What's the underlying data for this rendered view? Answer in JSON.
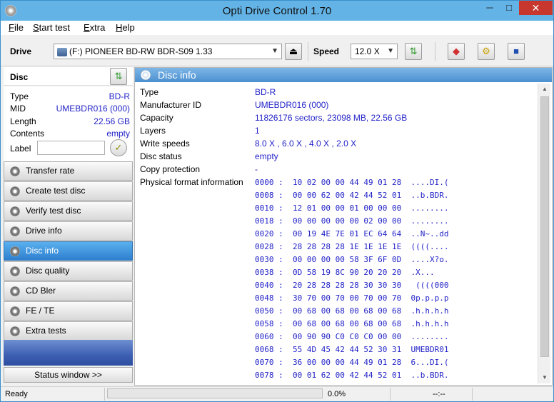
{
  "window": {
    "title": "Opti Drive Control 1.70",
    "min": "─",
    "max": "□",
    "close": "✕"
  },
  "menu": [
    {
      "label": "File",
      "u": "F",
      "rest": "ile"
    },
    {
      "label": "Start test",
      "u": "S",
      "rest": "tart test"
    },
    {
      "label": "Extra",
      "u": "E",
      "rest": "xtra"
    },
    {
      "label": "Help",
      "u": "H",
      "rest": "elp"
    }
  ],
  "toolbar": {
    "drive_label": "Drive",
    "drive_value": "(F:)   PIONEER BD-RW   BDR-S09 1.33",
    "speed_label": "Speed",
    "speed_value": "12.0 X"
  },
  "disc": {
    "title": "Disc",
    "props": [
      {
        "k": "Type",
        "v": "BD-R"
      },
      {
        "k": "MID",
        "v": "UMEBDR016 (000)"
      },
      {
        "k": "Length",
        "v": "22.56 GB"
      },
      {
        "k": "Contents",
        "v": "empty"
      }
    ],
    "label_text": "Label"
  },
  "nav": [
    "Transfer rate",
    "Create test disc",
    "Verify test disc",
    "Drive info",
    "Disc info",
    "Disc quality",
    "CD Bler",
    "FE / TE",
    "Extra tests"
  ],
  "nav_active": "Disc info",
  "status_button": "Status window >>",
  "panel": {
    "title": "Disc info",
    "rows": [
      {
        "k": "Type",
        "v": "BD-R"
      },
      {
        "k": "Manufacturer ID",
        "v": "UMEBDR016 (000)"
      },
      {
        "k": "Capacity",
        "v": "11826176 sectors, 23098 MB, 22.56 GB"
      },
      {
        "k": "Layers",
        "v": "1"
      },
      {
        "k": "Write speeds",
        "v": "8.0 X , 6.0 X , 4.0 X , 2.0 X"
      },
      {
        "k": "Disc status",
        "v": "empty"
      },
      {
        "k": "Copy protection",
        "v": "-"
      }
    ],
    "pfi_label": "Physical format information",
    "hex": [
      "0000 :  10 02 00 00 44 49 01 28  ....DI.(",
      "0008 :  00 00 62 00 42 44 52 01  ..b.BDR.",
      "0010 :  12 01 00 00 01 00 00 00  ........",
      "0018 :  00 00 00 00 00 02 00 00  ........",
      "0020 :  00 19 4E 7E 01 EC 64 64  ..N~..dd",
      "0028 :  28 28 28 28 1E 1E 1E 1E  ((((....",
      "0030 :  00 00 00 00 58 3F 6F 0D  ....X?o.",
      "0038 :  0D 58 19 8C 90 20 20 20  .X...   ",
      "0040 :  20 28 28 28 28 30 30 30   ((((000",
      "0048 :  30 70 00 70 00 70 00 70  0p.p.p.p",
      "0050 :  00 68 00 68 00 68 00 68  .h.h.h.h",
      "0058 :  00 68 00 68 00 68 00 68  .h.h.h.h",
      "0060 :  00 90 90 C0 C0 C0 00 00  ........",
      "0068 :  55 4D 45 42 44 52 30 31  UMEBDR01",
      "0070 :  36 00 00 00 44 49 01 28  6...DI.(",
      "0078 :  00 01 62 00 42 44 52 01  ..b.BDR."
    ]
  },
  "statusbar": {
    "left": "Ready",
    "progress": "0.0%",
    "right": "--:--"
  }
}
